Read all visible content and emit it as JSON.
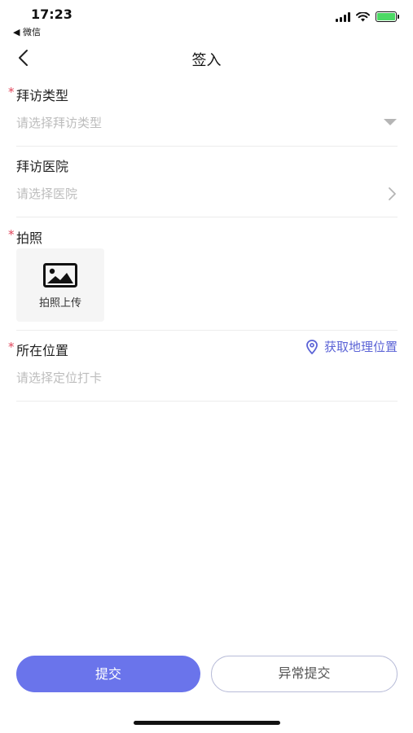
{
  "status_bar": {
    "time": "17:23",
    "back_app": "◀ 微信"
  },
  "nav": {
    "title": "签入"
  },
  "form": {
    "visit_type": {
      "label": "拜访类型",
      "required_mark": "*",
      "placeholder": "请选择拜访类型"
    },
    "hospital": {
      "label": "拜访医院",
      "placeholder": "请选择医院"
    },
    "photo": {
      "label": "拍照",
      "required_mark": "*",
      "upload_label": "拍照上传"
    },
    "location": {
      "label": "所在位置",
      "required_mark": "*",
      "action_label": "获取地理位置",
      "placeholder": "请选择定位打卡"
    }
  },
  "buttons": {
    "submit": "提交",
    "abnormal_submit": "异常提交"
  },
  "colors": {
    "accent": "#6a74eb",
    "link": "#5b63d6",
    "required": "#e0455a",
    "placeholder": "#bdbdbd"
  }
}
